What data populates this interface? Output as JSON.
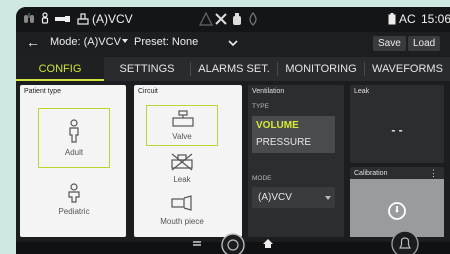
{
  "status": {
    "mode": "(A)VCV",
    "power": "AC",
    "time": "15:06"
  },
  "topbar": {
    "mode_label": "Mode: (A)VCV",
    "preset_label": "Preset: None",
    "save": "Save",
    "load": "Load"
  },
  "tabs": [
    "CONFIG",
    "SETTINGS",
    "ALARMS SET.",
    "MONITORING",
    "WAVEFORMS"
  ],
  "patient": {
    "title": "Patient type",
    "adult": "Adult",
    "pediatric": "Pediatric",
    "selected": "Adult"
  },
  "circuit": {
    "title": "Circuit",
    "valve": "Valve",
    "leak": "Leak",
    "mouth": "Mouth piece",
    "selected": "Valve"
  },
  "ventilation": {
    "title": "Ventilation",
    "type_label": "TYPE",
    "volume": "VOLUME",
    "pressure": "PRESSURE",
    "selected": "VOLUME",
    "mode_label": "MODE",
    "mode_value": "(A)VCV"
  },
  "leak": {
    "title": "Leak",
    "value": "- -"
  },
  "calibration": {
    "title": "Calibration",
    "menu": "⋮"
  },
  "colors": {
    "accent": "#cfe33c",
    "background": "#1c1d1f",
    "panel_light": "#f4f4f4",
    "panel_dark": "#2c2d30"
  }
}
